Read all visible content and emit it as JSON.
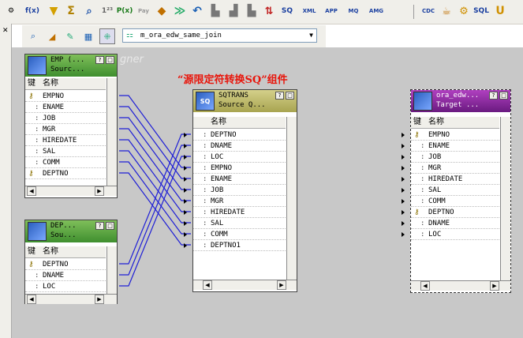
{
  "toolbar_top": {
    "items": [
      {
        "icon": "source-analyzer-icon",
        "text": ""
      },
      {
        "icon": "function-icon",
        "text": "f(x)"
      },
      {
        "icon": "filter-icon",
        "text": ""
      },
      {
        "icon": "aggregator-icon",
        "text": "Σ"
      },
      {
        "icon": "lookup-icon",
        "text": ""
      },
      {
        "icon": "rank-icon",
        "text": "1²³"
      },
      {
        "icon": "procedure-icon",
        "text": "P(x)"
      },
      {
        "icon": "pay-icon",
        "text": "Pay"
      },
      {
        "icon": "router-icon",
        "text": ""
      },
      {
        "icon": "normalizer-icon",
        "text": ""
      },
      {
        "icon": "update-strategy-icon",
        "text": ""
      },
      {
        "icon": "bar-chart-icon",
        "text": ""
      },
      {
        "icon": "column-chart-icon",
        "text": ""
      },
      {
        "icon": "sorter-icon",
        "text": ""
      },
      {
        "icon": "sql-icon",
        "text": "SQ"
      },
      {
        "icon": "xml-icon",
        "text": "XML"
      },
      {
        "icon": "app-icon",
        "text": "APP"
      },
      {
        "icon": "mq-icon",
        "text": "MQ"
      },
      {
        "icon": "amg-icon",
        "text": "AMG"
      },
      {
        "icon": "cdc-icon",
        "text": "CDC"
      },
      {
        "icon": "java-icon",
        "text": ""
      },
      {
        "icon": "gear-icon",
        "text": ""
      },
      {
        "icon": "sql-transformation-icon",
        "text": "SQL"
      },
      {
        "icon": "union-icon",
        "text": "U"
      }
    ]
  },
  "toolbar_mapping": {
    "icons": [
      "zoom-icon",
      "layout-icon",
      "edit-icon",
      "grid-icon",
      "arrange-icon"
    ],
    "mapping_selector": {
      "icon": "mapping-icon",
      "value": "m_ora_edw_same_join"
    }
  },
  "canvas": {
    "ghost_text": "gner",
    "caption": "“源限定符转换SQ”组件"
  },
  "col_headers": {
    "key": "键",
    "name": "名称"
  },
  "sources": [
    {
      "title": "EMP (...",
      "subtitle": "Sourc...",
      "ports": [
        {
          "name": "EMPNO",
          "key": true
        },
        {
          "name": "ENAME",
          "key": false
        },
        {
          "name": "JOB",
          "key": false
        },
        {
          "name": "MGR",
          "key": false
        },
        {
          "name": "HIREDATE",
          "key": false
        },
        {
          "name": "SAL",
          "key": false
        },
        {
          "name": "COMM",
          "key": false
        },
        {
          "name": "DEPTNO",
          "key": true
        }
      ]
    },
    {
      "title": "DEP...",
      "subtitle": "Sou...",
      "ports": [
        {
          "name": "DEPTNO",
          "key": true
        },
        {
          "name": "DNAME",
          "key": false
        },
        {
          "name": "LOC",
          "key": false
        }
      ]
    }
  ],
  "source_qualifier": {
    "title": "SQTRANS",
    "subtitle": "Source Q...",
    "icon_text": "SQ",
    "ports": [
      "DEPTNO",
      "DNAME",
      "LOC",
      "EMPNO",
      "ENAME",
      "JOB",
      "MGR",
      "HIREDATE",
      "SAL",
      "COMM",
      "DEPTNO1"
    ]
  },
  "target": {
    "title": "ora_edw...",
    "subtitle": "Target ...",
    "ports": [
      {
        "name": "EMPNO",
        "key": true
      },
      {
        "name": "ENAME",
        "key": false
      },
      {
        "name": "JOB",
        "key": false
      },
      {
        "name": "MGR",
        "key": false
      },
      {
        "name": "HIREDATE",
        "key": false
      },
      {
        "name": "SAL",
        "key": false
      },
      {
        "name": "COMM",
        "key": false
      },
      {
        "name": "DEPTNO",
        "key": true
      },
      {
        "name": "DNAME",
        "key": false
      },
      {
        "name": "LOC",
        "key": false
      }
    ]
  },
  "header_buttons": {
    "help": "?",
    "close": "□"
  },
  "colors": {
    "link": "#1f1fd6",
    "caption": "#e8160c",
    "canvas": "#c8c8c8"
  }
}
